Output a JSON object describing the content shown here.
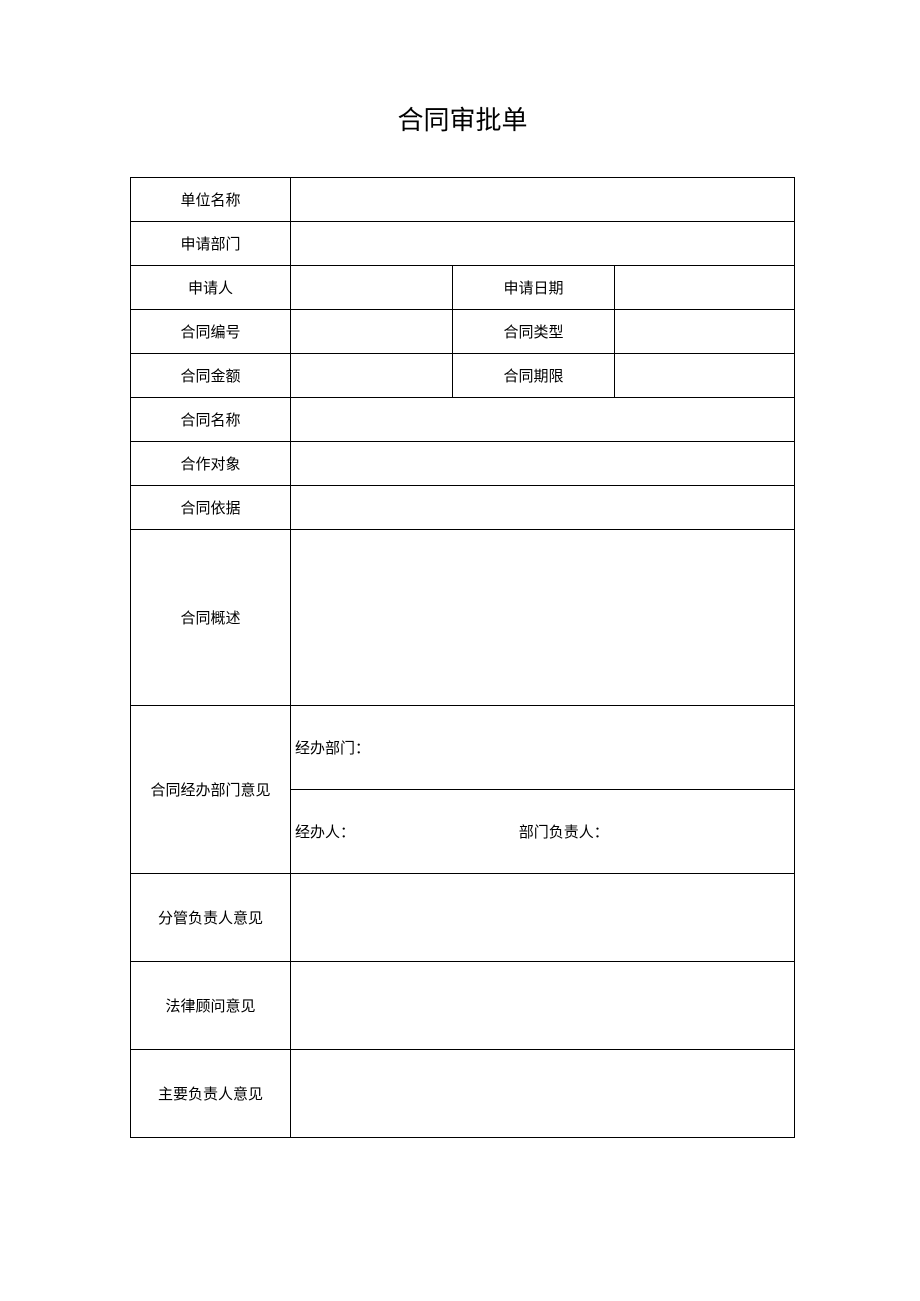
{
  "title": "合同审批单",
  "rows": {
    "unit_name": {
      "label": "单位名称",
      "value": ""
    },
    "apply_dept": {
      "label": "申请部门",
      "value": ""
    },
    "applicant": {
      "label": "申请人",
      "value": ""
    },
    "apply_date": {
      "label": "申请日期",
      "value": ""
    },
    "contract_no": {
      "label": "合同编号",
      "value": ""
    },
    "contract_type": {
      "label": "合同类型",
      "value": ""
    },
    "contract_amount": {
      "label": "合同金额",
      "value": ""
    },
    "contract_term": {
      "label": "合同期限",
      "value": ""
    },
    "contract_name": {
      "label": "合同名称",
      "value": ""
    },
    "partner": {
      "label": "合作对象",
      "value": ""
    },
    "contract_basis": {
      "label": "合同依据",
      "value": ""
    },
    "contract_summary": {
      "label": "合同概述",
      "value": ""
    },
    "handling_dept_opinion": {
      "label": "合同经办部门意见"
    },
    "handling_dept_line": "经办部门：",
    "handler_line": "经办人：",
    "dept_head_line": "部门负责人：",
    "branch_leader_opinion": {
      "label": "分管负责人意见",
      "value": ""
    },
    "legal_opinion": {
      "label": "法律顾问意见",
      "value": ""
    },
    "main_leader_opinion": {
      "label": "主要负责人意见",
      "value": ""
    }
  }
}
